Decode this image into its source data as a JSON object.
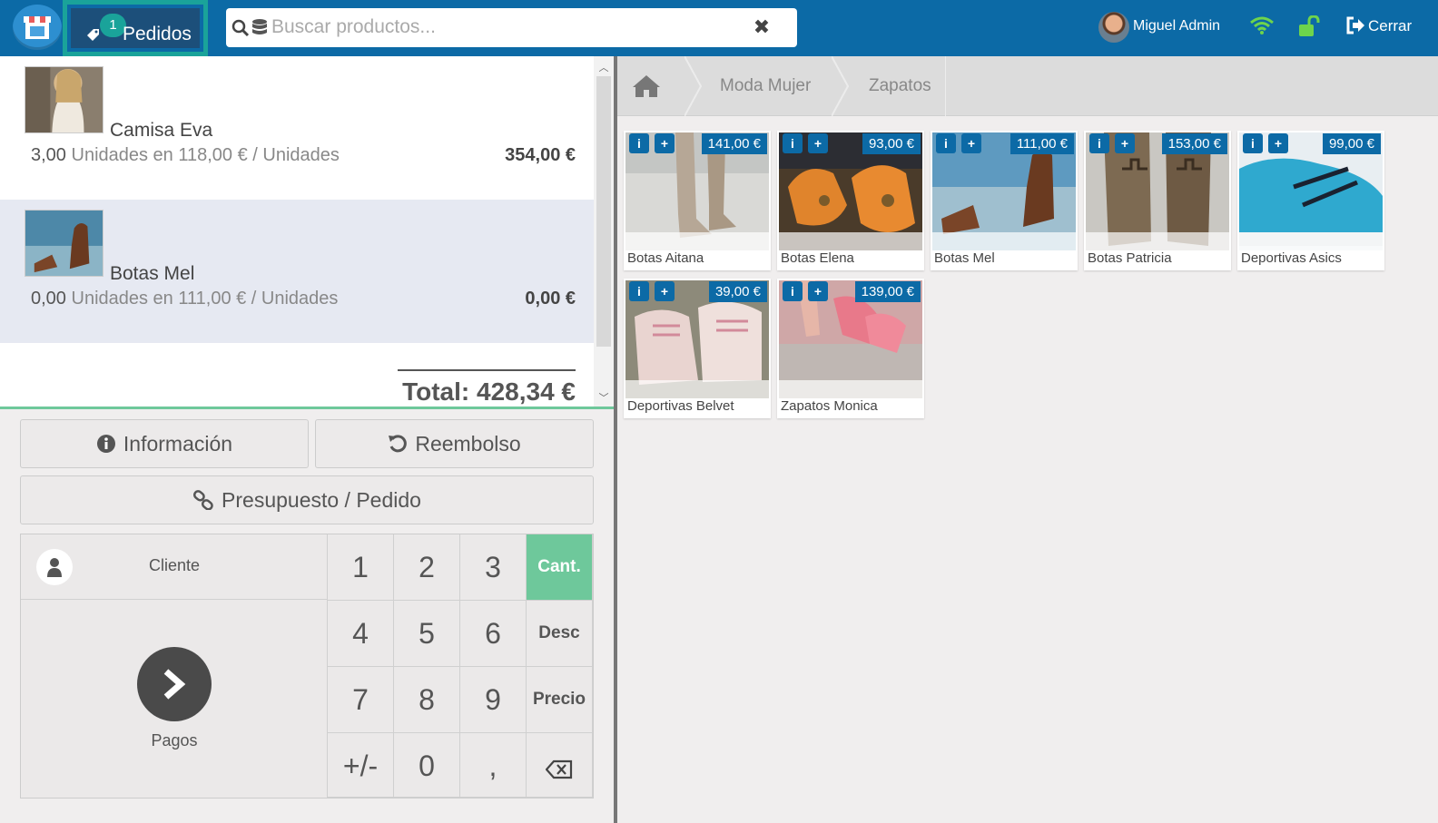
{
  "topbar": {
    "orders_badge": "1",
    "orders_label": "Pedidos",
    "search_placeholder": "Buscar productos...",
    "user_name": "Miguel Admin",
    "logout_label": "Cerrar"
  },
  "order": {
    "lines": [
      {
        "name": "Camisa Eva",
        "qty": "3,00",
        "unit_text": "Unidades en 118,00 € / Unidades",
        "price": "354,00 €",
        "selected": false
      },
      {
        "name": "Botas Mel",
        "qty": "0,00",
        "unit_text": "Unidades en 111,00 € / Unidades",
        "price": "0,00 €",
        "selected": true
      }
    ],
    "total": "Total: 428,34 €"
  },
  "controls": {
    "info": "Información",
    "refund": "Reembolso",
    "quote": "Presupuesto / Pedido"
  },
  "numpad": {
    "customer": "Cliente",
    "payment": "Pagos",
    "keys": [
      "1",
      "2",
      "3",
      "4",
      "5",
      "6",
      "7",
      "8",
      "9",
      "+/-",
      "0",
      ","
    ],
    "modes": [
      "Cant.",
      "Desc",
      "Precio"
    ],
    "active_mode": "Cant."
  },
  "breadcrumbs": [
    "Moda Mujer",
    "Zapatos"
  ],
  "products": [
    {
      "name": "Botas Aitana",
      "price": "141,00 €"
    },
    {
      "name": "Botas Elena",
      "price": "93,00 €"
    },
    {
      "name": "Botas Mel",
      "price": "111,00 €"
    },
    {
      "name": "Botas Patricia",
      "price": "153,00 €"
    },
    {
      "name": "Deportivas Asics",
      "price": "99,00 €"
    },
    {
      "name": "Deportivas Belvet",
      "price": "39,00 €"
    },
    {
      "name": "Zapatos Monica",
      "price": "139,00 €"
    }
  ],
  "colors": {
    "primary": "#0c6aa6",
    "accent": "#1aa39a",
    "active": "#6ec89b"
  }
}
